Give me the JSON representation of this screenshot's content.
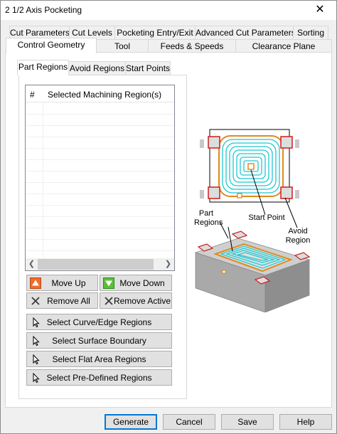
{
  "window": {
    "title": "2 1/2 Axis Pocketing",
    "close_glyph": "✕"
  },
  "tabs_row1": [
    "Cut Parameters",
    "Cut Levels",
    "Pocketing Entry/Exit",
    "Advanced Cut Parameters",
    "Sorting"
  ],
  "tabs_row2": [
    "Control Geometry",
    "Tool",
    "Feeds & Speeds",
    "Clearance Plane"
  ],
  "active_tab": "Control Geometry",
  "subtabs": [
    "Part Regions",
    "Avoid Regions",
    "Start Points"
  ],
  "active_subtab": "Part Regions",
  "regions_list": {
    "col_index": "#",
    "col_name": "Selected Machining Region(s)",
    "rows": []
  },
  "buttons": {
    "move_up": "Move Up",
    "move_down": "Move Down",
    "remove_all": "Remove All",
    "remove_active": "Remove Active",
    "select_curve_edge": "Select Curve/Edge Regions",
    "select_surface_boundary": "Select Surface Boundary",
    "select_flat_area": "Select Flat Area Regions",
    "select_predefined": "Select Pre-Defined Regions"
  },
  "diagram": {
    "part_regions": "Part Regions",
    "start_point": "Start Point",
    "avoid_region": "Avoid Region",
    "colors": {
      "toolpath": "#1ec8d2",
      "boundary": "#e08a1e",
      "avoid": "#cc1f1f"
    }
  },
  "footer": {
    "generate": "Generate",
    "cancel": "Cancel",
    "save": "Save",
    "help": "Help"
  }
}
